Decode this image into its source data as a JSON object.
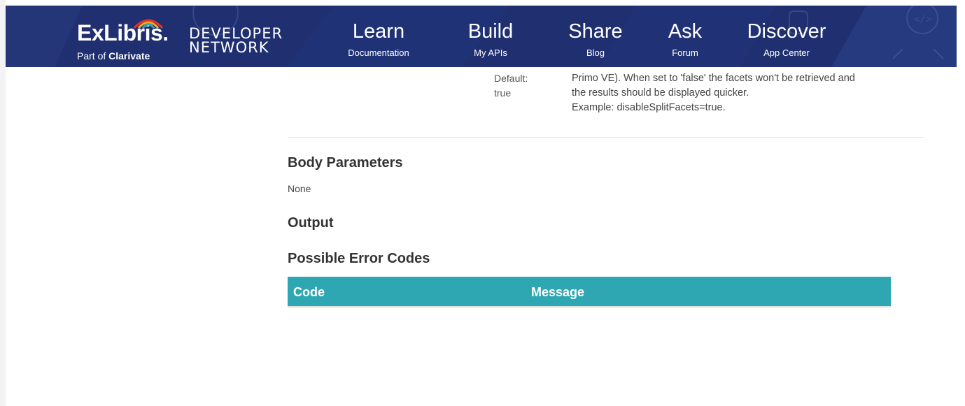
{
  "header": {
    "logo": {
      "brand": "ExLibris.",
      "part_of": "Part of ",
      "parent": "Clarivate"
    },
    "developer_network": [
      "DEVELOPER",
      "NETWORK"
    ],
    "nav": [
      {
        "label": "Learn",
        "sub": "Documentation"
      },
      {
        "label": "Build",
        "sub": "My APIs"
      },
      {
        "label": "Share",
        "sub": "Blog"
      },
      {
        "label": "Ask",
        "sub": "Forum"
      },
      {
        "label": "Discover",
        "sub": "App Center"
      }
    ],
    "colors": {
      "background": "#1f2f70",
      "accent_arc": [
        "#e4312b",
        "#f7a81b",
        "#2ea7b3"
      ]
    }
  },
  "param": {
    "default_label": "Default:",
    "default_value": "true",
    "description_lines": [
      "Primo VE). When set to 'false' the facets won't be retrieved and",
      "the results should be displayed quicker.",
      "Example: disableSplitFacets=true."
    ]
  },
  "sections": {
    "body_parameters": "Body Parameters",
    "body_parameters_value": "None",
    "output": "Output",
    "error_codes": "Possible Error Codes"
  },
  "error_table": {
    "headers": [
      "Code",
      "Message"
    ],
    "header_color": "#2ea7b3"
  }
}
